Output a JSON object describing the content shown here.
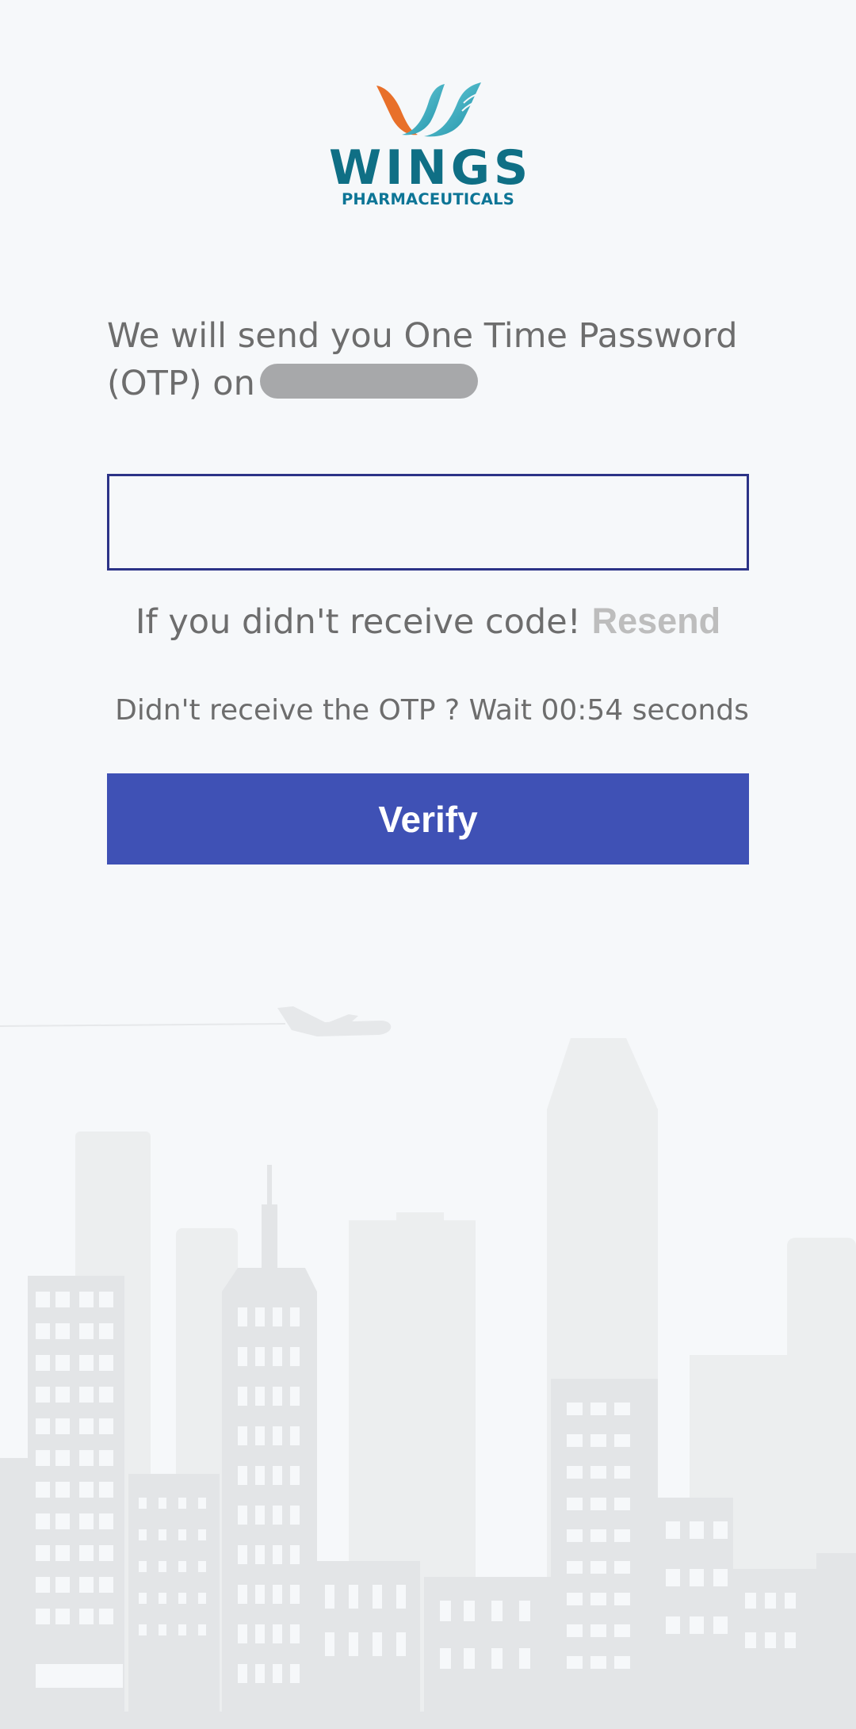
{
  "logo": {
    "word": "WINGS",
    "tagline": "PHARMACEUTICALS",
    "icon": "wings-logo-icon"
  },
  "otp_message": {
    "text_before": "We will send you One Time Password (OTP) on",
    "phone_number_redacted": true
  },
  "otp_input": {
    "value": "",
    "placeholder": ""
  },
  "resend": {
    "prompt": "If you didn't receive code!",
    "link_label": "Resend"
  },
  "wait_message": "Didn't receive the OTP ? Wait 00:54 seconds",
  "verify_button": {
    "label": "Verify"
  },
  "colors": {
    "background": "#f6f8fa",
    "primary": "#3f51b5",
    "input_border": "#2c3387",
    "logo_teal": "#0f6f85",
    "logo_orange": "#e8702a",
    "text": "#6d6d6d",
    "resend_disabled": "#bdbdbd"
  }
}
